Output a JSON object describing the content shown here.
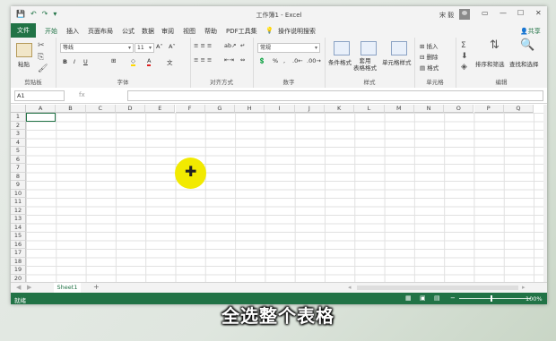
{
  "app": {
    "title": "工作簿1 - Excel",
    "user": "宋 毅",
    "qat": [
      "save-icon",
      "undo-icon",
      "redo-icon",
      "customize-icon"
    ],
    "window_buttons": [
      "—",
      "☐",
      "✕"
    ]
  },
  "tabs": {
    "file": "文件",
    "items": [
      "开始",
      "插入",
      "页面布局",
      "公式",
      "数据",
      "审阅",
      "视图",
      "帮助",
      "PDF工具集"
    ],
    "active": "开始",
    "tellme": "操作说明搜索",
    "share": "共享"
  },
  "ribbon": {
    "clipboard": {
      "label": "剪贴板",
      "paste": "粘贴"
    },
    "font": {
      "label": "字体",
      "name": "等线",
      "size": "11"
    },
    "alignment": {
      "label": "对齐方式"
    },
    "number": {
      "label": "数字",
      "format": "常规"
    },
    "styles": {
      "label": "样式",
      "conditional": "条件格式",
      "table": "套用\n表格格式",
      "cell": "单元格样式"
    },
    "cells": {
      "label": "单元格",
      "insert": "插入",
      "delete": "删除",
      "format": "格式"
    },
    "editing": {
      "label": "编辑",
      "sort": "排序和筛选",
      "find": "查找和选择"
    }
  },
  "formula_bar": {
    "name_box": "A1",
    "fx": "fx",
    "value": ""
  },
  "grid": {
    "columns": [
      "A",
      "B",
      "C",
      "D",
      "E",
      "F",
      "G",
      "H",
      "I",
      "J",
      "K",
      "L",
      "M",
      "N",
      "O",
      "P",
      "Q"
    ],
    "rows": [
      "1",
      "2",
      "3",
      "4",
      "5",
      "6",
      "7",
      "8",
      "9",
      "10",
      "11",
      "12",
      "13",
      "14",
      "15",
      "16",
      "17",
      "18",
      "19",
      "20"
    ],
    "selected": "A1"
  },
  "sheets": {
    "tabs": [
      "Sheet1"
    ],
    "add": "+"
  },
  "statusbar": {
    "ready": "就绪",
    "zoom": "100%"
  },
  "overlay": {
    "subtitle": "全选整个表格"
  }
}
